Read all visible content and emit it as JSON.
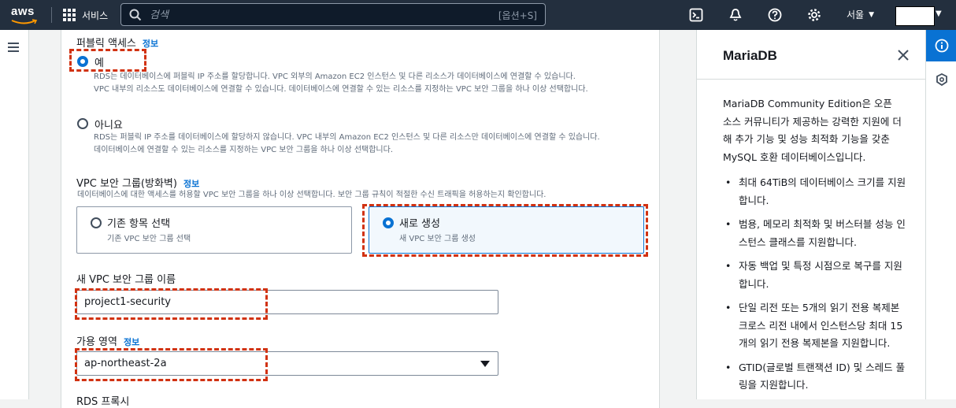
{
  "topnav": {
    "logo": "aws",
    "services_label": "서비스",
    "search_placeholder": "검색",
    "search_shortcut": "[옵션+S]",
    "region_label": "서울",
    "icons": [
      "cloudshell-icon",
      "bell-icon",
      "help-icon",
      "settings-icon"
    ]
  },
  "form": {
    "public_access": {
      "label": "퍼블릭 액세스",
      "info": "정보",
      "options": [
        {
          "label": "예",
          "selected": true,
          "desc": "RDS는 데이터베이스에 퍼블릭 IP 주소를 할당합니다. VPC 외부의 Amazon EC2 인스턴스 및 다른 리소스가 데이터베이스에 연결할 수 있습니다.\nVPC 내부의 리소스도 데이터베이스에 연결할 수 있습니다. 데이터베이스에 연결할 수 있는 리소스를 지정하는 VPC 보안 그룹을 하나 이상 선택합니다."
        },
        {
          "label": "아니요",
          "selected": false,
          "desc": "RDS는 퍼블릭 IP 주소를 데이터베이스에 할당하지 않습니다. VPC 내부의 Amazon EC2 인스턴스 및 다른 리소스만 데이터베이스에 연결할 수 있습니다.\n데이터베이스에 연결할 수 있는 리소스를 지정하는 VPC 보안 그룹을 하나 이상 선택합니다."
        }
      ]
    },
    "vpc_sg": {
      "label": "VPC 보안 그룹(방화벽)",
      "info": "정보",
      "desc": "데이터베이스에 대한 액세스를 허용할 VPC 보안 그룹을 하나 이상 선택합니다. 보안 그룹 규칙이 적절한 수신 트래픽을 허용하는지 확인합니다.",
      "tiles": [
        {
          "title": "기존 항목 선택",
          "desc": "기존 VPC 보안 그룹 선택",
          "selected": false
        },
        {
          "title": "새로 생성",
          "desc": "새 VPC 보안 그룹 생성",
          "selected": true
        }
      ]
    },
    "new_sg_name": {
      "label": "새 VPC 보안 그룹 이름",
      "value": "project1-security"
    },
    "availability_zone": {
      "label": "가용 영역",
      "info": "정보",
      "value": "ap-northeast-2a"
    },
    "next_section_label": "RDS 프록시"
  },
  "panel": {
    "title": "MariaDB",
    "intro": "MariaDB Community Edition은 오픈 소스 커뮤니티가 제공하는 강력한 지원에 더해 추가 기능 및 성능 최적화 기능을 갖춘 MySQL 호환 데이터베이스입니다.",
    "bullets": [
      "최대 64TiB의 데이터베이스 크기를 지원합니다.",
      "범용, 메모리 최적화 및 버스터블 성능 인스턴스 클래스를 지원합니다.",
      "자동 백업 및 특정 시점으로 복구를 지원합니다.",
      "단일 리전 또는 5개의 읽기 전용 복제본 크로스 리전 내에서 인스턴스당 최대 15개의 읽기 전용 복제본을 지원합니다.",
      "GTID(글로벌 트랜잭션 ID) 및 스레드 풀링을 지원합니다."
    ]
  },
  "colors": {
    "nav_bg": "#232f3e",
    "accent": "#0972d3",
    "highlight": "#d13212"
  }
}
